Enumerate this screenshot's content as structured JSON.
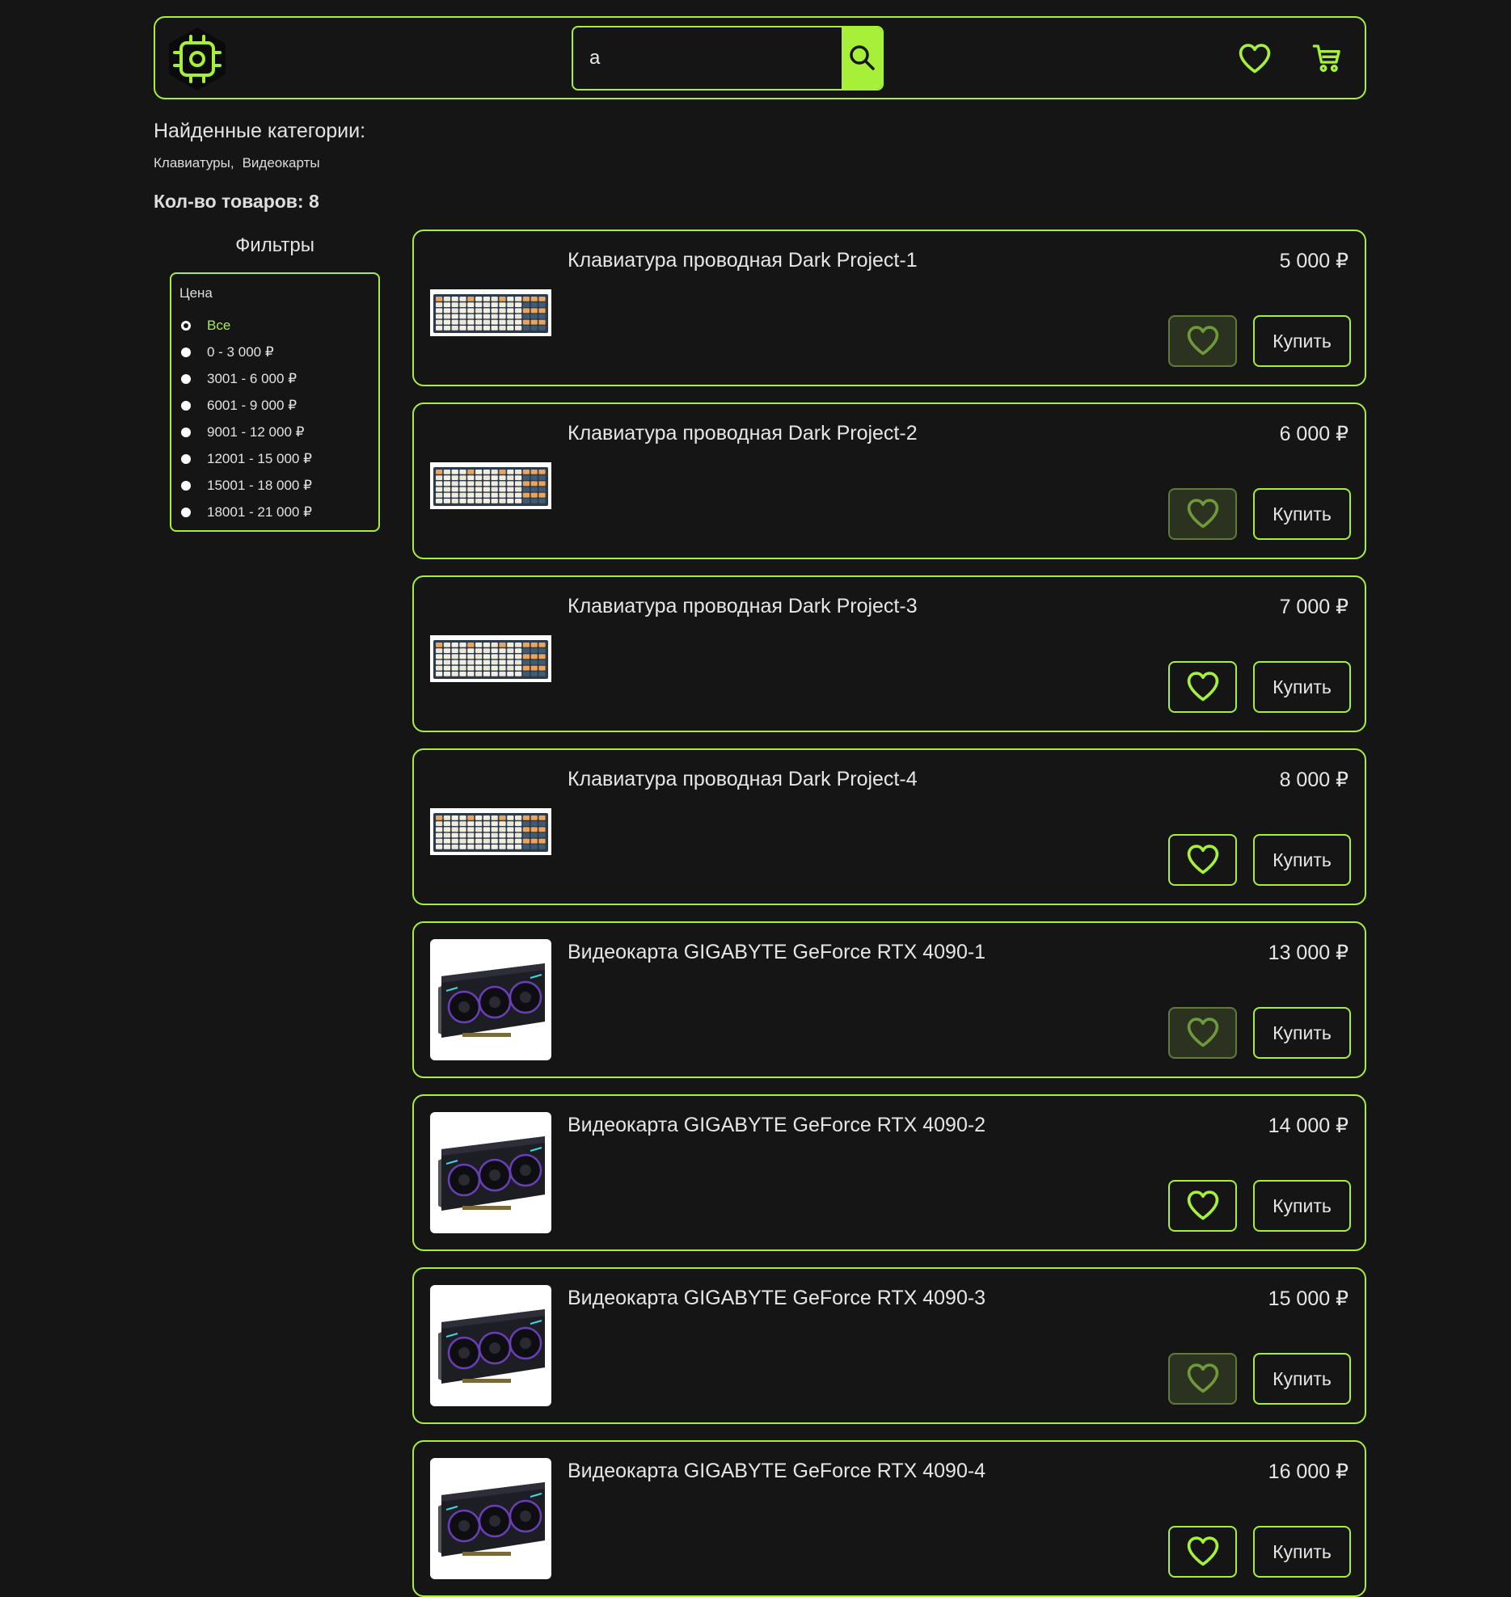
{
  "search": {
    "value": "a"
  },
  "found": {
    "title": "Найденные категории:",
    "categories": [
      "Клавиатуры,",
      "Видеокарты"
    ]
  },
  "count_label": "Кол-во товаров: 8",
  "filters": {
    "title": "Фильтры",
    "price_label": "Цена",
    "options": [
      "Все",
      "0 - 3 000 ₽",
      "3001 - 6 000 ₽",
      "6001 - 9 000 ₽",
      "9001 - 12 000 ₽",
      "12001 - 15 000 ₽",
      "15001 - 18 000 ₽",
      "18001 - 21 000 ₽"
    ],
    "selected_index": 0
  },
  "products": [
    {
      "title": "Клавиатура проводная Dark Project-1",
      "price": "5 000 ₽",
      "buy_label": "Купить",
      "image": "keyboard",
      "favorite": true
    },
    {
      "title": "Клавиатура проводная Dark Project-2",
      "price": "6 000 ₽",
      "buy_label": "Купить",
      "image": "keyboard",
      "favorite": true
    },
    {
      "title": "Клавиатура проводная Dark Project-3",
      "price": "7 000 ₽",
      "buy_label": "Купить",
      "image": "keyboard",
      "favorite": false
    },
    {
      "title": "Клавиатура проводная Dark Project-4",
      "price": "8 000 ₽",
      "buy_label": "Купить",
      "image": "keyboard",
      "favorite": false
    },
    {
      "title": "Видеокарта GIGABYTE GeForce RTX 4090-1",
      "price": "13 000 ₽",
      "buy_label": "Купить",
      "image": "gpu",
      "favorite": true
    },
    {
      "title": "Видеокарта GIGABYTE GeForce RTX 4090-2",
      "price": "14 000 ₽",
      "buy_label": "Купить",
      "image": "gpu",
      "favorite": false
    },
    {
      "title": "Видеокарта GIGABYTE GeForce RTX 4090-3",
      "price": "15 000 ₽",
      "buy_label": "Купить",
      "image": "gpu",
      "favorite": true
    },
    {
      "title": "Видеокарта GIGABYTE GeForce RTX 4090-4",
      "price": "16 000 ₽",
      "buy_label": "Купить",
      "image": "gpu",
      "favorite": false
    }
  ],
  "colors": {
    "accent": "#a6f03a",
    "background": "#151515",
    "favorite_active_bg": "#2c3220"
  },
  "icons": {
    "logo": "chip-logo-icon",
    "search": "search-icon",
    "favorites": "heart-icon",
    "cart": "cart-icon"
  }
}
